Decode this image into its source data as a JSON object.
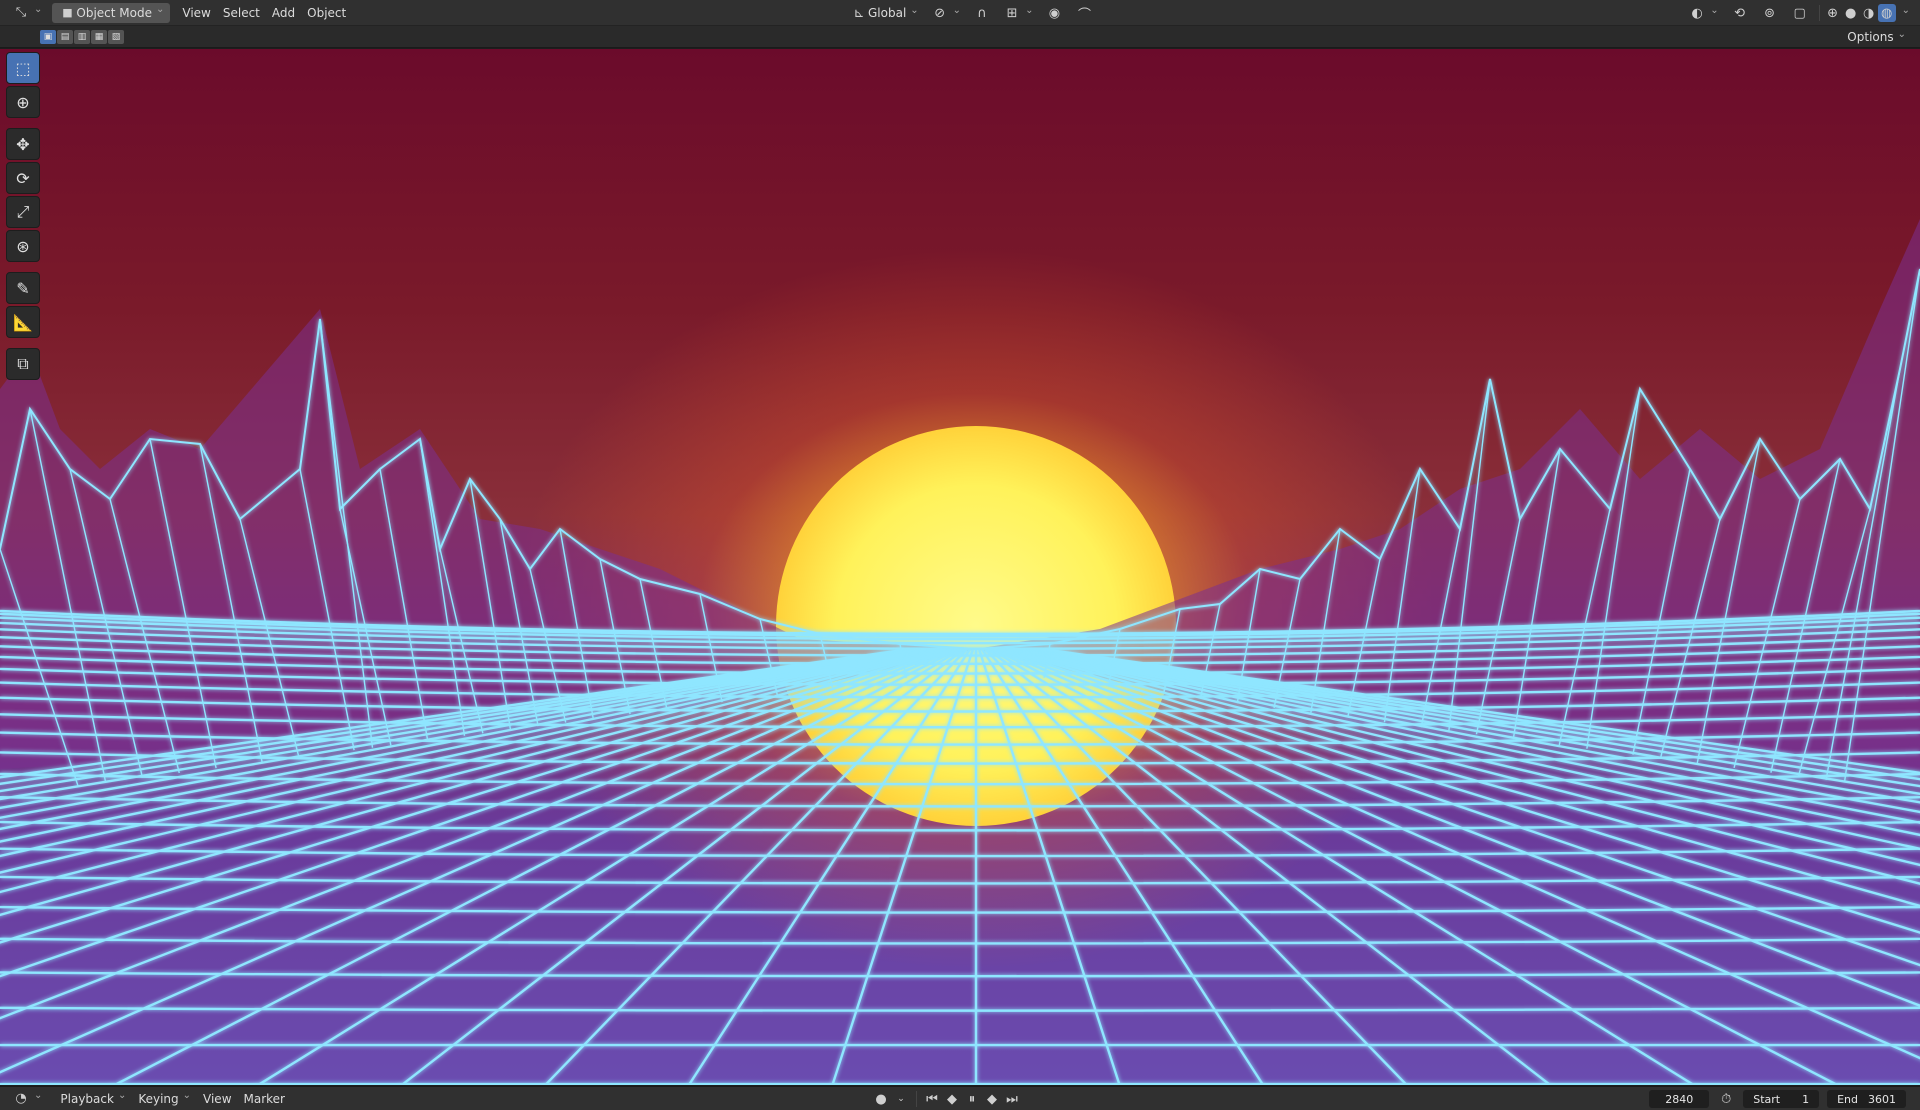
{
  "header": {
    "mode_label": "Object Mode",
    "menu": [
      "View",
      "Select",
      "Add",
      "Object"
    ],
    "orientation_label": "Global",
    "options_label": "Options"
  },
  "timeline": {
    "menu": [
      "Playback",
      "Keying",
      "View",
      "Marker"
    ],
    "current_frame": "2840",
    "start_label": "Start",
    "start_value": "1",
    "end_label": "End",
    "end_value": "3601"
  },
  "colors": {
    "grid_line": "#8fe6ff",
    "sun": "#fff25a",
    "sky_top": "#6b0b2b",
    "ground": "#6a4cb0"
  },
  "icons": {
    "editor_type": "axis-icon",
    "toolbar": [
      "select-box-icon",
      "cursor-icon",
      "move-icon",
      "rotate-icon",
      "scale-icon",
      "transform-icon",
      "annotate-icon",
      "measure-icon",
      "add-cube-icon"
    ]
  }
}
